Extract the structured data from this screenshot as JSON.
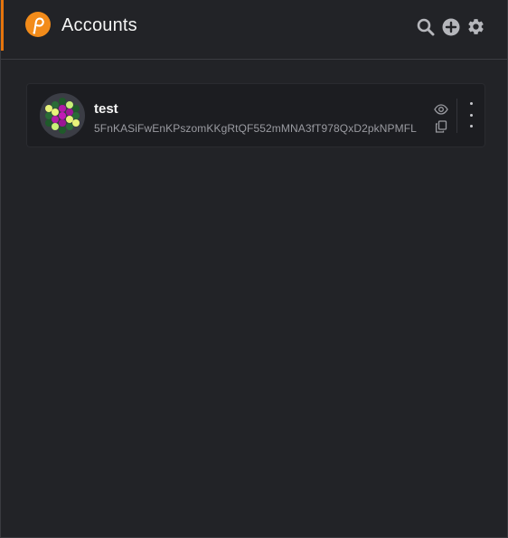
{
  "header": {
    "title": "Accounts",
    "logo_icon": "polkadot-logo-icon",
    "accent_color": "#e6740c",
    "actions": [
      {
        "icon": "search-icon"
      },
      {
        "icon": "add-circle-icon"
      },
      {
        "icon": "gear-icon"
      }
    ]
  },
  "account": {
    "name": "test",
    "address": "5FnKASiFwEnKPszomKKgRtQF552mMNA3fT978QxD2pkNPMFL",
    "identicon_icon": "identicon-avatar",
    "actions": [
      {
        "icon": "eye-icon"
      },
      {
        "icon": "copy-icon"
      }
    ],
    "menu_icon": "vertical-dots-icon"
  }
}
